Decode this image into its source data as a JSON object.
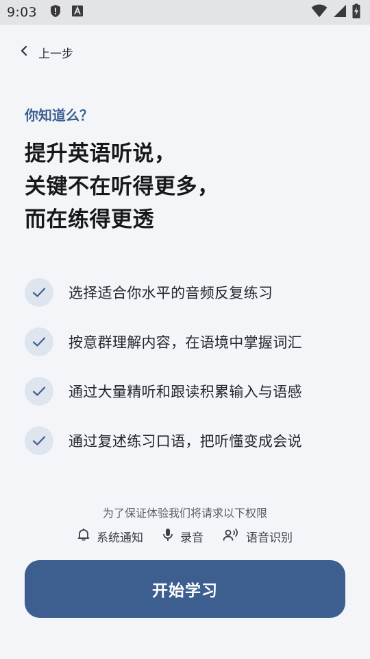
{
  "status_bar": {
    "time": "9:03",
    "icons": [
      "shield-icon",
      "a-notification-icon",
      "wifi-icon",
      "cellular-icon",
      "battery-charging-icon"
    ]
  },
  "nav": {
    "back_label": "上一步",
    "back_icon": "chevron-left-icon"
  },
  "intro": {
    "eyebrow": "你知道么？",
    "headline": [
      "提升英语听说，",
      "关键不在听得更多，",
      "而在练得更透"
    ]
  },
  "features": [
    {
      "text": "选择适合你水平的音频反复练习",
      "icon": "check-icon"
    },
    {
      "text": "按意群理解内容，在语境中掌握词汇",
      "icon": "check-icon"
    },
    {
      "text": "通过大量精听和跟读积累输入与语感",
      "icon": "check-icon"
    },
    {
      "text": "通过复述练习口语，把听懂变成会说",
      "icon": "check-icon"
    }
  ],
  "permissions": {
    "note": "为了保证体验我们将请求以下权限",
    "items": [
      {
        "label": "系统通知",
        "icon": "bell-icon"
      },
      {
        "label": "录音",
        "icon": "microphone-icon"
      },
      {
        "label": "语音识别",
        "icon": "voice-recognition-icon"
      }
    ]
  },
  "cta": {
    "label": "开始学习"
  },
  "colors": {
    "accent": "#3c5f8f",
    "background": "#f4f5f9",
    "check_bg": "#dfe5ee",
    "status_bar": "#e3e4e6"
  }
}
